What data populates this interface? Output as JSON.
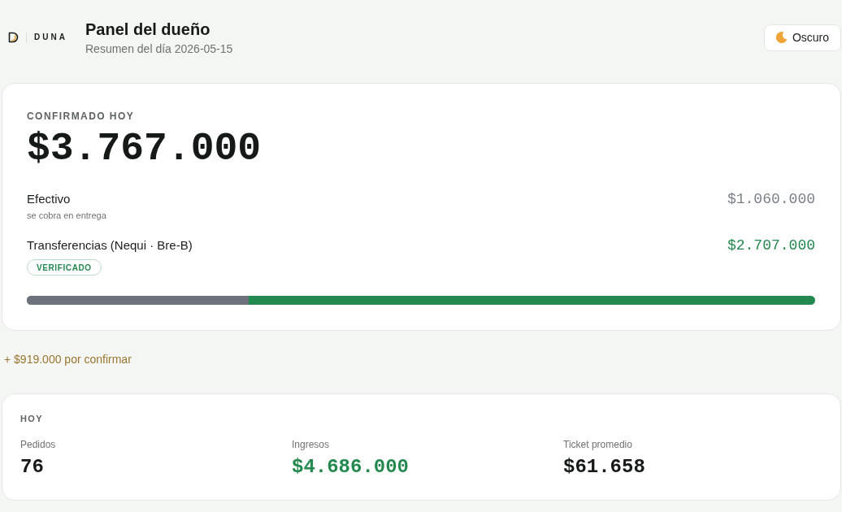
{
  "header": {
    "logo": {
      "wordmark": "DUNA"
    },
    "title": "Panel del dueño",
    "subtitle": "Resumen del día 2026-05-15",
    "theme_button": {
      "label": "Oscuro"
    }
  },
  "confirmed": {
    "label": "CONFIRMADO HOY",
    "amount": "$3.767.000",
    "methods": [
      {
        "kind": "cash",
        "name": "Efectivo",
        "note": "se cobra en entrega",
        "amount": "$1.060.000"
      },
      {
        "kind": "transfer",
        "name": "Transferencias (Nequi · Bre-B)",
        "badge": "VERIFICADO",
        "amount": "$2.707.000"
      }
    ],
    "split_bar": {
      "level": 0.281
    }
  },
  "pending": {
    "text": "+ $919.000 por confirmar"
  },
  "today": {
    "label": "HOY",
    "stats": [
      {
        "kind": "count",
        "label": "Pedidos",
        "value": "76"
      },
      {
        "kind": "revenue",
        "label": "Ingresos",
        "value": "$4.686.000"
      },
      {
        "kind": "average",
        "label": "Ticket promedio",
        "value": "$61.658"
      }
    ]
  }
}
